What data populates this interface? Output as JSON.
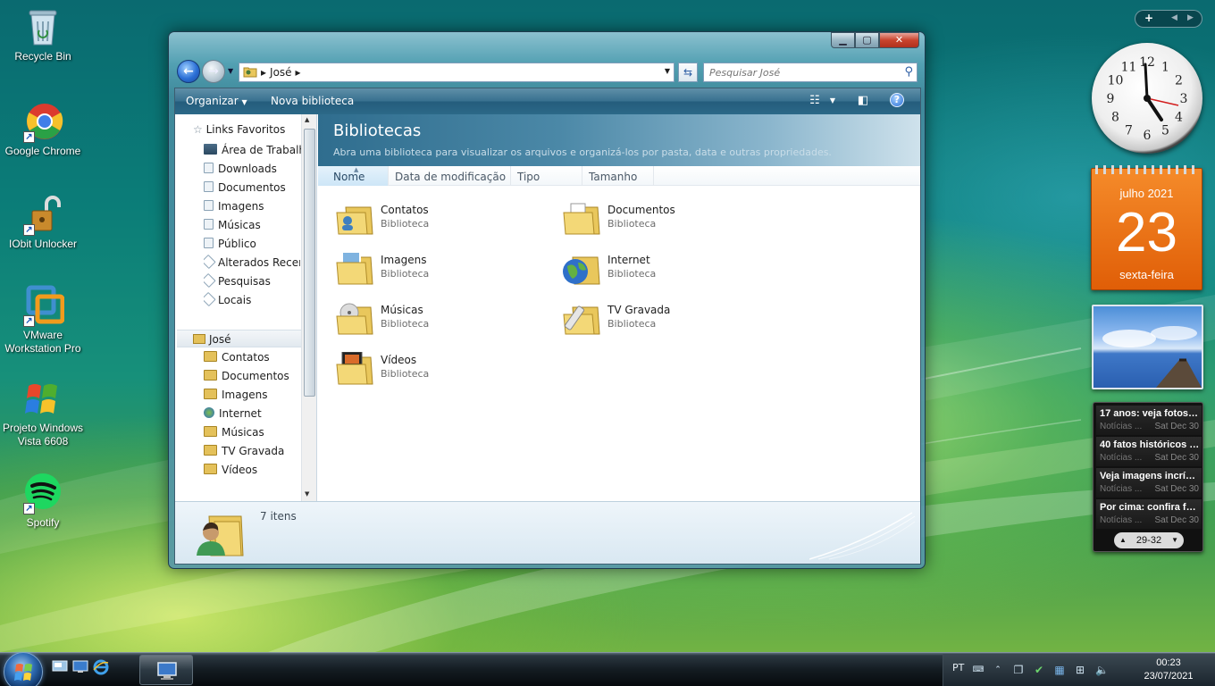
{
  "desktop": {
    "icons": [
      {
        "label": "Recycle Bin"
      },
      {
        "label": "Google Chrome"
      },
      {
        "label": "IObit Unlocker"
      },
      {
        "label": "VMware Workstation Pro"
      },
      {
        "label": "Projeto Windows Vista 6608"
      },
      {
        "label": "Spotify"
      }
    ]
  },
  "window": {
    "controls": {
      "minimize": "▁",
      "maximize": "▢",
      "close": "✕"
    },
    "address": {
      "segment": "José"
    },
    "search": {
      "placeholder": "Pesquisar José"
    },
    "toolbar": {
      "organize": "Organizar",
      "new_library": "Nova biblioteca"
    },
    "nav": {
      "favorites_header": "Links Favoritos",
      "favorites": [
        {
          "label": "Área de Trabalho"
        },
        {
          "label": "Downloads"
        },
        {
          "label": "Documentos"
        },
        {
          "label": "Imagens"
        },
        {
          "label": "Músicas"
        },
        {
          "label": "Público"
        },
        {
          "label": "Alterados Recentemente"
        },
        {
          "label": "Pesquisas"
        },
        {
          "label": "Locais"
        }
      ],
      "user_header": "José",
      "user_items": [
        {
          "label": "Contatos"
        },
        {
          "label": "Documentos"
        },
        {
          "label": "Imagens"
        },
        {
          "label": "Internet"
        },
        {
          "label": "Músicas"
        },
        {
          "label": "TV Gravada"
        },
        {
          "label": "Vídeos"
        }
      ]
    },
    "banner": {
      "title": "Bibliotecas",
      "subtitle": "Abra uma biblioteca para visualizar os arquivos e organizá-los por pasta, data e outras propriedades."
    },
    "columns": [
      "Nome",
      "Data de modificação",
      "Tipo",
      "Tamanho"
    ],
    "libraries": [
      {
        "name": "Contatos",
        "type": "Biblioteca",
        "icon": "contacts-library-icon"
      },
      {
        "name": "Documentos",
        "type": "Biblioteca",
        "icon": "documents-library-icon"
      },
      {
        "name": "Imagens",
        "type": "Biblioteca",
        "icon": "pictures-library-icon"
      },
      {
        "name": "Internet",
        "type": "Biblioteca",
        "icon": "internet-library-icon"
      },
      {
        "name": "Músicas",
        "type": "Biblioteca",
        "icon": "music-library-icon"
      },
      {
        "name": "TV Gravada",
        "type": "Biblioteca",
        "icon": "recorded-tv-library-icon"
      },
      {
        "name": "Vídeos",
        "type": "Biblioteca",
        "icon": "videos-library-icon"
      }
    ],
    "details": {
      "count": "7 itens"
    }
  },
  "gadgets": {
    "clock": {
      "numbers": [
        "12",
        "1",
        "2",
        "3",
        "4",
        "5",
        "6",
        "7",
        "8",
        "9",
        "10",
        "11"
      ]
    },
    "calendar": {
      "month": "julho 2021",
      "day": "23",
      "weekday": "sexta-feira"
    },
    "news": {
      "items": [
        {
          "headline": "17 anos: veja fotos d...",
          "source": "Notícias ...",
          "date": "Sat Dec 30"
        },
        {
          "headline": "40 fatos históricos e...",
          "source": "Notícias ...",
          "date": "Sat Dec 30"
        },
        {
          "headline": "Veja imagens incríve...",
          "source": "Notícias ...",
          "date": "Sat Dec 30"
        },
        {
          "headline": "Por cima: confira fot...",
          "source": "Notícias ...",
          "date": "Sat Dec 30"
        }
      ],
      "pager": "29-32"
    }
  },
  "taskbar": {
    "language": "PT",
    "time": "00:23",
    "date": "23/07/2021"
  },
  "colors": {
    "accent": "#2c6988",
    "calendar": "#e8700f"
  }
}
